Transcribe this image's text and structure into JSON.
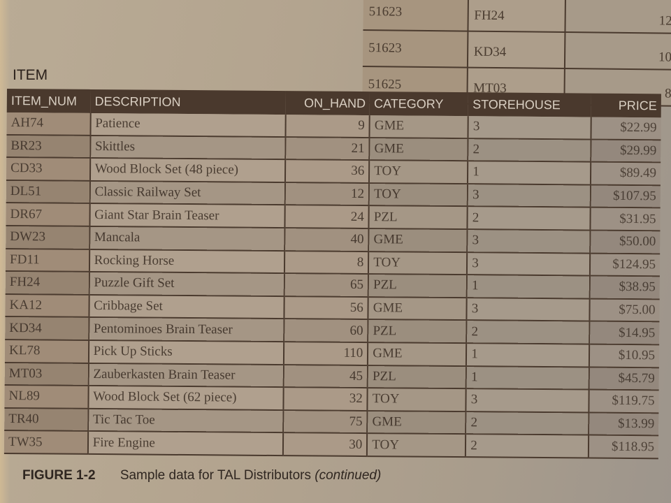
{
  "top_table": {
    "rows": [
      {
        "order_num": "51623",
        "item_num": "FH24",
        "num_ordered": "12"
      },
      {
        "order_num": "51623",
        "item_num": "KD34",
        "num_ordered": "10"
      },
      {
        "order_num": "51625",
        "item_num": "MT03",
        "num_ordered": "8"
      }
    ]
  },
  "item_table": {
    "title": "ITEM",
    "columns": [
      "ITEM_NUM",
      "DESCRIPTION",
      "ON_HAND",
      "CATEGORY",
      "STOREHOUSE",
      "PRICE"
    ],
    "rows": [
      {
        "item_num": "AH74",
        "description": "Patience",
        "on_hand": "9",
        "category": "GME",
        "storehouse": "3",
        "price": "$22.99"
      },
      {
        "item_num": "BR23",
        "description": "Skittles",
        "on_hand": "21",
        "category": "GME",
        "storehouse": "2",
        "price": "$29.99"
      },
      {
        "item_num": "CD33",
        "description": "Wood Block Set (48 piece)",
        "on_hand": "36",
        "category": "TOY",
        "storehouse": "1",
        "price": "$89.49"
      },
      {
        "item_num": "DL51",
        "description": "Classic Railway Set",
        "on_hand": "12",
        "category": "TOY",
        "storehouse": "3",
        "price": "$107.95"
      },
      {
        "item_num": "DR67",
        "description": "Giant Star Brain Teaser",
        "on_hand": "24",
        "category": "PZL",
        "storehouse": "2",
        "price": "$31.95"
      },
      {
        "item_num": "DW23",
        "description": "Mancala",
        "on_hand": "40",
        "category": "GME",
        "storehouse": "3",
        "price": "$50.00"
      },
      {
        "item_num": "FD11",
        "description": "Rocking Horse",
        "on_hand": "8",
        "category": "TOY",
        "storehouse": "3",
        "price": "$124.95"
      },
      {
        "item_num": "FH24",
        "description": "Puzzle Gift Set",
        "on_hand": "65",
        "category": "PZL",
        "storehouse": "1",
        "price": "$38.95"
      },
      {
        "item_num": "KA12",
        "description": "Cribbage Set",
        "on_hand": "56",
        "category": "GME",
        "storehouse": "3",
        "price": "$75.00"
      },
      {
        "item_num": "KD34",
        "description": "Pentominoes Brain Teaser",
        "on_hand": "60",
        "category": "PZL",
        "storehouse": "2",
        "price": "$14.95"
      },
      {
        "item_num": "KL78",
        "description": "Pick Up Sticks",
        "on_hand": "110",
        "category": "GME",
        "storehouse": "1",
        "price": "$10.95"
      },
      {
        "item_num": "MT03",
        "description": "Zauberkasten Brain Teaser",
        "on_hand": "45",
        "category": "PZL",
        "storehouse": "1",
        "price": "$45.79"
      },
      {
        "item_num": "NL89",
        "description": "Wood Block Set (62 piece)",
        "on_hand": "32",
        "category": "TOY",
        "storehouse": "3",
        "price": "$119.75"
      },
      {
        "item_num": "TR40",
        "description": "Tic Tac Toe",
        "on_hand": "75",
        "category": "GME",
        "storehouse": "2",
        "price": "$13.99"
      },
      {
        "item_num": "TW35",
        "description": "Fire Engine",
        "on_hand": "30",
        "category": "TOY",
        "storehouse": "2",
        "price": "$118.95"
      }
    ]
  },
  "caption": {
    "figure_label": "FIGURE 1-2",
    "text": "Sample data for TAL Distributors",
    "continued": "(continued)"
  }
}
